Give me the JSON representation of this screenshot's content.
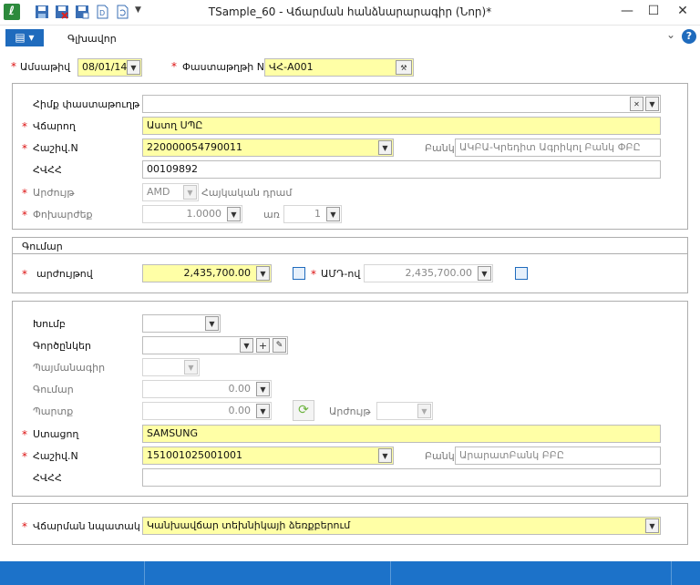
{
  "window": {
    "title": "TSample_60 - Վճարման հանձնարարագիր (Նոր)*",
    "minimize": "—",
    "maximize": "☐",
    "close": "✕"
  },
  "ribbon": {
    "file_label": "▤ ▾",
    "tab_home": "Գլխավոր",
    "help": "?"
  },
  "header": {
    "date_label": "Ամսաթիվ",
    "date_value": "08/01/14",
    "docno_label": "Փաստաթղթի N",
    "docno_value": "ՎՀ-A001"
  },
  "payer": {
    "base_doc_label": "Հիմք փաստաթուղթ",
    "base_doc_value": "",
    "payer_label": "Վճարող",
    "payer_value": "Աստղ ՍՊԸ",
    "account_label": "Հաշիվ.N",
    "account_value": "220000054790011",
    "bank_label": "Բանկ",
    "bank_value": "ԱԿԲԱ-Կրեդիտ Ագրիկոլ Բանկ ՓԲԸ",
    "tin_label": "ՀՎՀՀ",
    "tin_value": "00109892",
    "currency_label": "Արժույթ",
    "currency_code": "AMD",
    "currency_name": "Հայկական դրամ",
    "rate_label": "Փոխարժեք",
    "rate_value": "1.0000",
    "per_label": "առ",
    "per_value": "1"
  },
  "amount": {
    "section_label": "Գումար",
    "currency_amount_label": "արժույթով",
    "currency_amount_value": "2,435,700.00",
    "amd_label": "ԱՄԴ-ով",
    "amd_value": "2,435,700.00"
  },
  "details": {
    "group_label": "Խումբ",
    "group_value": "",
    "operations_label": "Գործընկեր",
    "operations_value": "",
    "contract_label": "Պայմանագիր",
    "contract_value": "",
    "sum_label": "Գումար",
    "sum_value": "0.00",
    "debt_label": "Պարտք",
    "debt_value": "0.00",
    "debt_currency_label": "Արժույթ",
    "debt_currency_value": "",
    "receiver_label": "Ստացող",
    "receiver_value": "SAMSUNG",
    "account_label": "Հաշիվ.N",
    "account_value": "151001025001001",
    "bank_label": "Բանկ",
    "bank_value": "ԱրարատԲանկ ԲԲԸ",
    "tin_label": "ՀՎՀՀ",
    "tin_value": ""
  },
  "purpose": {
    "label": "Վճարման նպատակ",
    "value": "Կանխավճար տեխնիկայի ձեռքբերում"
  },
  "colors": {
    "accent": "#1c72c9",
    "required": "#dd1111",
    "highlight": "#ffffa6"
  }
}
